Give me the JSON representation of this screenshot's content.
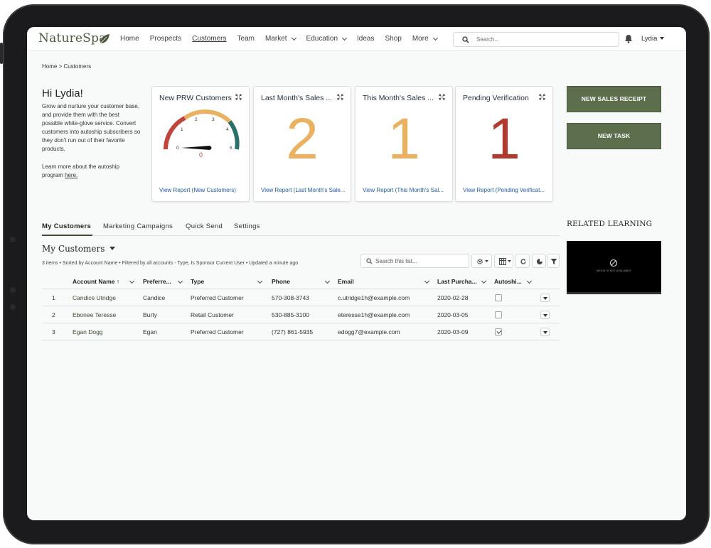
{
  "header": {
    "logo": "NatureSpa",
    "nav": [
      {
        "label": "Home",
        "dropdown": false,
        "active": false
      },
      {
        "label": "Prospects",
        "dropdown": false,
        "active": false
      },
      {
        "label": "Customers",
        "dropdown": false,
        "active": true
      },
      {
        "label": "Team",
        "dropdown": false,
        "active": false
      },
      {
        "label": "Market",
        "dropdown": true,
        "active": false
      },
      {
        "label": "Education",
        "dropdown": true,
        "active": false
      },
      {
        "label": "Ideas",
        "dropdown": false,
        "active": false
      },
      {
        "label": "Shop",
        "dropdown": false,
        "active": false
      },
      {
        "label": "More",
        "dropdown": true,
        "active": false
      }
    ],
    "search_placeholder": "Search...",
    "user": "Lydia"
  },
  "breadcrumb": "Home > Customers",
  "intro": {
    "greeting": "Hi Lydia!",
    "body": "Grow and nurture your customer base, and provide them with the best possible white-glove service. Convert customers into autoship subscribers so they don't run out of their favorite products.",
    "learn_prefix": "Learn more about the autoship program ",
    "learn_link": "here."
  },
  "cards": [
    {
      "title": "New PRW Customers",
      "kind": "gauge",
      "value": "0",
      "gauge_ticks": [
        "0",
        "1",
        "2",
        "3",
        "4",
        "5"
      ],
      "link": "View Report (New Customers)"
    },
    {
      "title": "Last Month's Sales ...",
      "kind": "number",
      "value": "2",
      "color": "#eab160",
      "link": "View Report (Last Month's Sale..."
    },
    {
      "title": "This Month's Sales ...",
      "kind": "number",
      "value": "1",
      "color": "#eab160",
      "link": "View Report (This Month's Sal..."
    },
    {
      "title": "Pending Verification",
      "kind": "number",
      "value": "1",
      "color": "#b03a2e",
      "link": "View Report (Pending Verificat..."
    }
  ],
  "actions": {
    "new_sales_receipt": "NEW SALES RECEIPT",
    "new_task": "NEW TASK"
  },
  "related_learning": {
    "title": "RELATED LEARNING",
    "video_text": "MEDIA IS NOT AVAILABLE"
  },
  "tabs": [
    "My Customers",
    "Marketing Campaigns",
    "Quick Send",
    "Settings"
  ],
  "list": {
    "title": "My Customers",
    "meta": "3 items • Sorted by Account Name • Filtered by all accounts - Type, Is Sponsor Current User • Updated a minute ago",
    "search_placeholder": "Search this list..."
  },
  "table": {
    "columns": [
      "Account Name ↑",
      "Preferre...",
      "Type",
      "Phone",
      "Email",
      "Last Purcha...",
      "Autoshi..."
    ],
    "rows": [
      {
        "num": "1",
        "account": "Candice Utridge",
        "preferred": "Candice",
        "type": "Preferred Customer",
        "phone": "570-308-3743",
        "email": "c.utridge1h@example.com",
        "last": "2020-02-28",
        "autoship": false
      },
      {
        "num": "2",
        "account": "Ebonee Teresse",
        "preferred": "Burty",
        "type": "Retail Customer",
        "phone": "530-885-3100",
        "email": "eteresse1h@example.com",
        "last": "2020-03-05",
        "autoship": false
      },
      {
        "num": "3",
        "account": "Egan Dogg",
        "preferred": "Egan",
        "type": "Preferred Customer",
        "phone": "(727) 861-5935",
        "email": "edogg7@example.com",
        "last": "2020-03-09",
        "autoship": true
      }
    ]
  },
  "colors": {
    "brand_green": "#5d6e4d",
    "link_blue": "#1a5ca8",
    "gauge_red": "#c1443b",
    "gauge_orange": "#eab160",
    "gauge_teal": "#2b6e6a"
  }
}
